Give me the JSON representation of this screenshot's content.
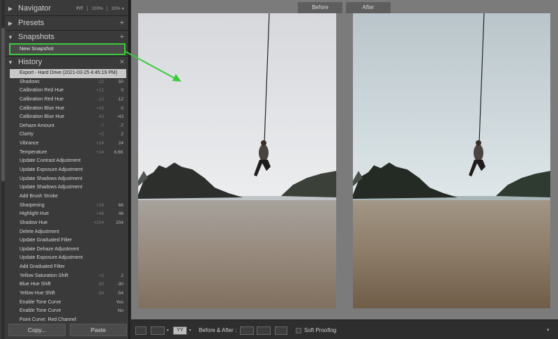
{
  "left_panel": {
    "navigator": {
      "title": "Navigator",
      "fit": "FIT",
      "zoom1": "100%",
      "zoom2": "33%"
    },
    "presets": {
      "title": "Presets",
      "add": "+"
    },
    "snapshots": {
      "title": "Snapshots",
      "add": "+",
      "items": [
        "New Snapshot"
      ]
    },
    "history": {
      "title": "History",
      "clear": "×",
      "items": [
        {
          "label": "Export - Hard Drive (2021-03-25 4:45:19 PM)",
          "delta": "",
          "value": ""
        },
        {
          "label": "Shadows",
          "delta": "-22",
          "value": "50"
        },
        {
          "label": "Calibration Red Hue",
          "delta": "+12",
          "value": "0"
        },
        {
          "label": "Calibration Red Hue",
          "delta": "-12",
          "value": "-12"
        },
        {
          "label": "Calibration Blue Hue",
          "delta": "+43",
          "value": "0"
        },
        {
          "label": "Calibration Blue Hue",
          "delta": "-43",
          "value": "-43"
        },
        {
          "label": "Dehaze Amount",
          "delta": "-7",
          "value": "-7"
        },
        {
          "label": "Clarity",
          "delta": "+2",
          "value": "2"
        },
        {
          "label": "Vibrance",
          "delta": "+24",
          "value": "24"
        },
        {
          "label": "Temperature",
          "delta": "+14",
          "value": "6.6K"
        },
        {
          "label": "Update Contrast Adjustment",
          "delta": "",
          "value": ""
        },
        {
          "label": "Update Exposure Adjustment",
          "delta": "",
          "value": ""
        },
        {
          "label": "Update Shadows Adjustment",
          "delta": "",
          "value": ""
        },
        {
          "label": "Update Shadows Adjustment",
          "delta": "",
          "value": ""
        },
        {
          "label": "Add Brush Stroke",
          "delta": "",
          "value": ""
        },
        {
          "label": "Sharpening",
          "delta": "+26",
          "value": "66"
        },
        {
          "label": "Highlight Hue",
          "delta": "+48",
          "value": "48"
        },
        {
          "label": "Shadow Hue",
          "delta": "+204",
          "value": "204"
        },
        {
          "label": "Delete Adjustment",
          "delta": "",
          "value": ""
        },
        {
          "label": "Update Graduated Filter",
          "delta": "",
          "value": ""
        },
        {
          "label": "Update Dehaze Adjustment",
          "delta": "",
          "value": ""
        },
        {
          "label": "Update Exposure Adjustment",
          "delta": "",
          "value": ""
        },
        {
          "label": "Add Graduated Filter",
          "delta": "",
          "value": ""
        },
        {
          "label": "Yellow Saturation Shift",
          "delta": "+2",
          "value": "2"
        },
        {
          "label": "Blue Hue Shift",
          "delta": "-30",
          "value": "-30"
        },
        {
          "label": "Yellow Hue Shift",
          "delta": "-54",
          "value": "-54"
        },
        {
          "label": "Enable Tone Curve",
          "delta": "",
          "value": "Yes"
        },
        {
          "label": "Enable Tone Curve",
          "delta": "",
          "value": "No"
        },
        {
          "label": "Point Curve: Red Channel",
          "delta": "",
          "value": ""
        }
      ]
    },
    "buttons": {
      "copy": "Copy...",
      "paste": "Paste"
    }
  },
  "view": {
    "before_label": "Before",
    "after_label": "After"
  },
  "toolbar": {
    "mode_label": "YY",
    "before_after_label": "Before & After :",
    "soft_proofing": "Soft Proofing"
  },
  "colors": {
    "accent": "#3ccb3c",
    "panel": "#3a3a3a",
    "selected": "#c9c9c9"
  }
}
